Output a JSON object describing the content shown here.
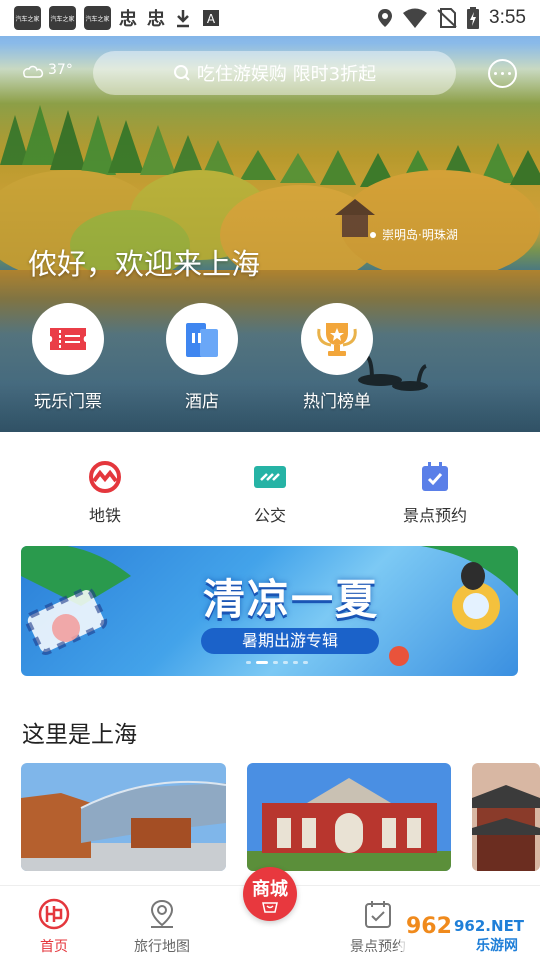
{
  "status_bar": {
    "app_icons": [
      "汽车之家",
      "汽车之家",
      "汽车之家"
    ],
    "time": "3:55"
  },
  "hero": {
    "weather": "37°",
    "search_placeholder": "吃住游娱购 限时3折起",
    "greeting": "侬好，欢迎来上海",
    "location": "崇明岛·明珠湖",
    "quick_links": [
      {
        "label": "玩乐门票",
        "icon": "ticket-icon"
      },
      {
        "label": "酒店",
        "icon": "hotel-building-icon"
      },
      {
        "label": "热门榜单",
        "icon": "trophy-icon"
      }
    ]
  },
  "transit": [
    {
      "label": "地铁",
      "icon": "metro-icon"
    },
    {
      "label": "公交",
      "icon": "bus-card-icon"
    },
    {
      "label": "景点预约",
      "icon": "calendar-check-icon"
    }
  ],
  "banner": {
    "title": "清凉一夏",
    "subtitle": "暑期出游专辑"
  },
  "section": {
    "title": "这里是上海"
  },
  "bottom_nav": [
    {
      "label": "首页",
      "icon": "home-logo-icon",
      "active": true
    },
    {
      "label": "旅行地图",
      "icon": "map-pin-icon",
      "active": false
    },
    {
      "label": "商城",
      "icon": "mall-bag-icon",
      "active": false
    },
    {
      "label": "景点预约",
      "icon": "calendar-check-icon",
      "active": false
    }
  ],
  "watermark": {
    "text1": "962.NET",
    "text2": "乐游网"
  },
  "colors": {
    "accent": "#e4373d",
    "brand_blue": "#3f8ef0"
  }
}
